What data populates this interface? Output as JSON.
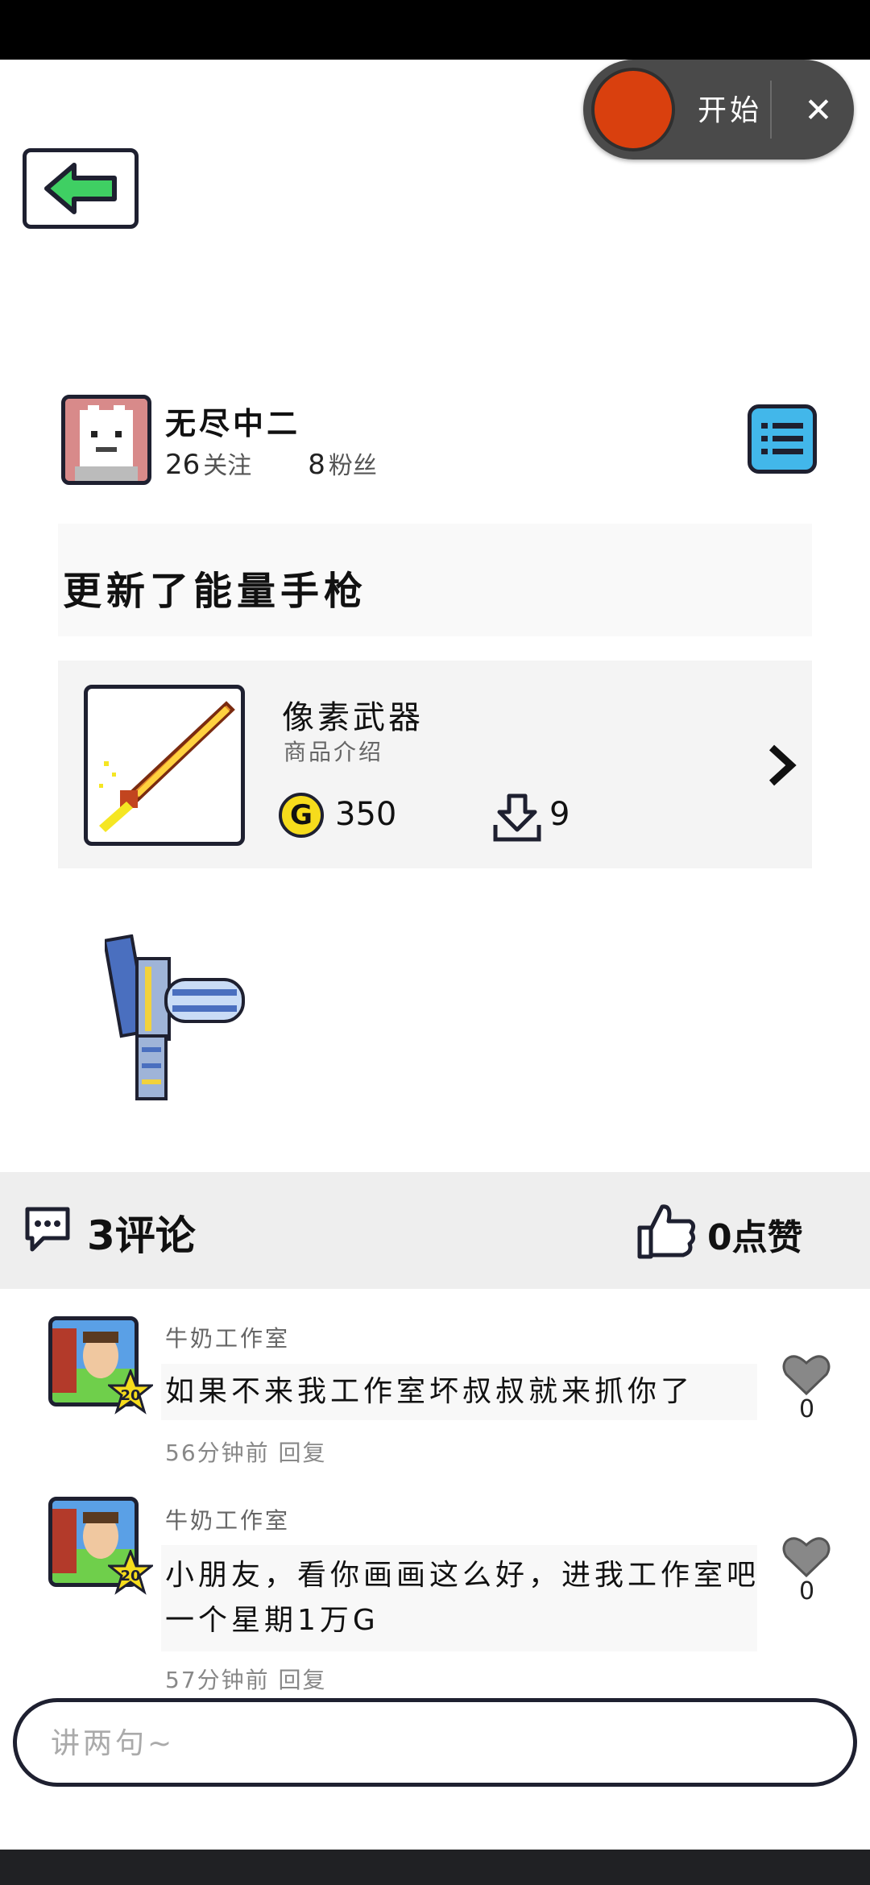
{
  "recorder": {
    "start_label": "开始",
    "close_symbol": "✕"
  },
  "profile": {
    "name": "无尽中二",
    "following_count": "26",
    "following_label": "关注",
    "followers_count": "8",
    "followers_label": "粉丝"
  },
  "post": {
    "title": "更新了能量手枪"
  },
  "product": {
    "name": "像素武器",
    "description": "商品介绍",
    "coin_symbol": "G",
    "price": "350",
    "downloads": "9"
  },
  "social": {
    "comment_count": "3",
    "comment_label": "评论",
    "like_count": "0",
    "like_label": "点赞"
  },
  "comments": [
    {
      "author": "牛奶工作室",
      "level": "20",
      "text": "如果不来我工作室坏叔叔就来抓你了",
      "time": "56分钟前",
      "reply_label": "回复",
      "likes": "0"
    },
    {
      "author": "牛奶工作室",
      "level": "20",
      "text": "小朋友，看你画画这么好，进我工作室吧一个星期1万G",
      "time": "57分钟前",
      "reply_label": "回复",
      "likes": "0"
    }
  ],
  "input": {
    "placeholder": "讲两句~"
  },
  "colors": {
    "accent_green": "#3fcf63",
    "menu_blue": "#42b7ea",
    "record_red": "#d9400e",
    "coin_yellow": "#f6dc1c"
  }
}
